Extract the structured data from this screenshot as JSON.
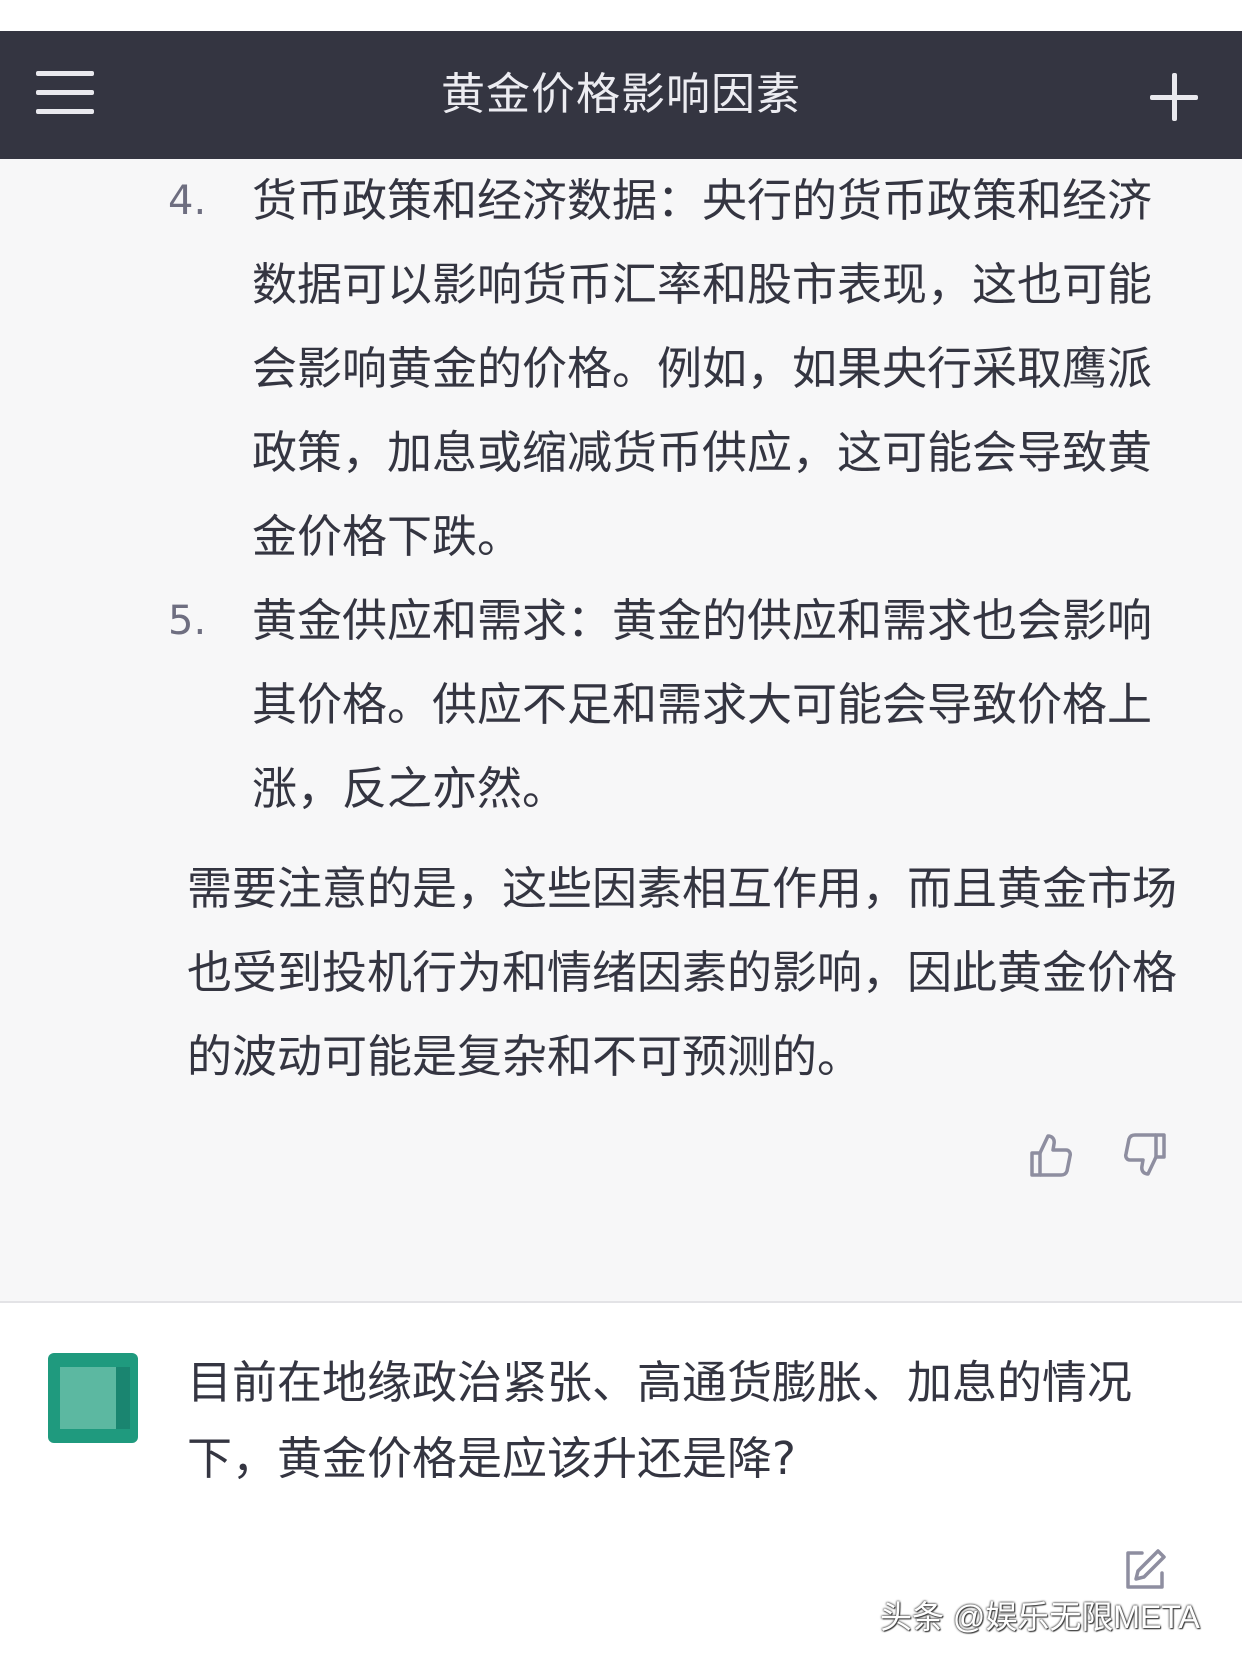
{
  "header": {
    "title": "黄金价格影响因素",
    "menu_icon": "hamburger-menu-icon",
    "new_chat_icon": "plus-icon"
  },
  "assistant": {
    "items": [
      {
        "number": "4.",
        "text": "货币政策和经济数据：央行的货币政策和经济数据可以影响货币汇率和股市表现，这也可能会影响黄金的价格。例如，如果央行采取鹰派政策，加息或缩减货币供应，这可能会导致黄金价格下跌。"
      },
      {
        "number": "5.",
        "text": "黄金供应和需求：黄金的供应和需求也会影响其价格。供应不足和需求大可能会导致价格上涨，反之亦然。"
      }
    ],
    "conclusion": "需要注意的是，这些因素相互作用，而且黄金市场也受到投机行为和情绪因素的影响，因此黄金价格的波动可能是复杂和不可预测的。",
    "feedback": {
      "thumbs_up_icon": "thumbs-up-icon",
      "thumbs_down_icon": "thumbs-down-icon"
    }
  },
  "user": {
    "avatar_color": "#1f9a7e",
    "message": "目前在地缘政治紧张、高通货膨胀、加息的情况下，黄金价格是应该升还是降?",
    "edit_icon": "edit-icon"
  },
  "watermark": "头条 @娱乐无限META",
  "colors": {
    "header_bg": "#343541",
    "assistant_bg": "#f7f7f8",
    "text": "#343541"
  }
}
